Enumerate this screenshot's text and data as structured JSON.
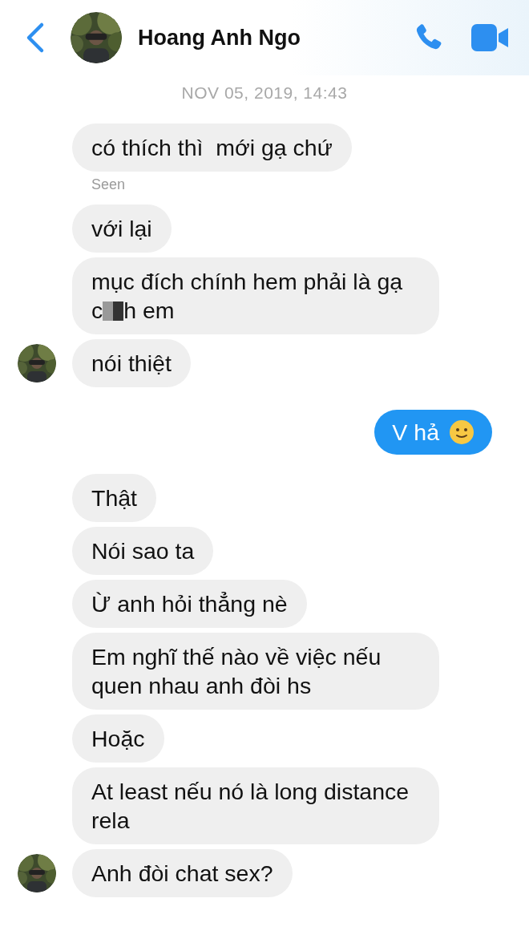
{
  "header": {
    "contact_name": "Hoang Anh Ngo"
  },
  "timestamp": "NOV 05, 2019, 14:43",
  "messages": [
    {
      "kind": "incoming",
      "text": "có thích thì  mới gạ chứ",
      "avatar": false
    },
    {
      "kind": "seen",
      "text": "Seen"
    },
    {
      "kind": "incoming",
      "text": "với lại",
      "avatar": false
    },
    {
      "kind": "incoming",
      "text": "mục đích chính hem phải là gạ",
      "text_before_censor": "c",
      "censored": true,
      "text_after": "h em",
      "avatar": false
    },
    {
      "kind": "incoming",
      "text": "nói thiệt",
      "avatar": true
    },
    {
      "kind": "outgoing",
      "text": "V hả",
      "emoji": true
    },
    {
      "kind": "incoming",
      "text": "Thật",
      "avatar": false
    },
    {
      "kind": "incoming",
      "text": "Nói sao ta",
      "avatar": false
    },
    {
      "kind": "incoming",
      "text": "Ừ anh hỏi thẳng nè",
      "avatar": false
    },
    {
      "kind": "incoming",
      "text": "Em nghĩ thế nào về việc nếu quen nhau anh đòi hs",
      "avatar": false
    },
    {
      "kind": "incoming",
      "text": "Hoặc",
      "avatar": false
    },
    {
      "kind": "incoming",
      "text": "At least nếu nó là long distance rela",
      "avatar": false
    },
    {
      "kind": "incoming",
      "text": "Anh đòi chat sex?",
      "avatar": true
    }
  ]
}
